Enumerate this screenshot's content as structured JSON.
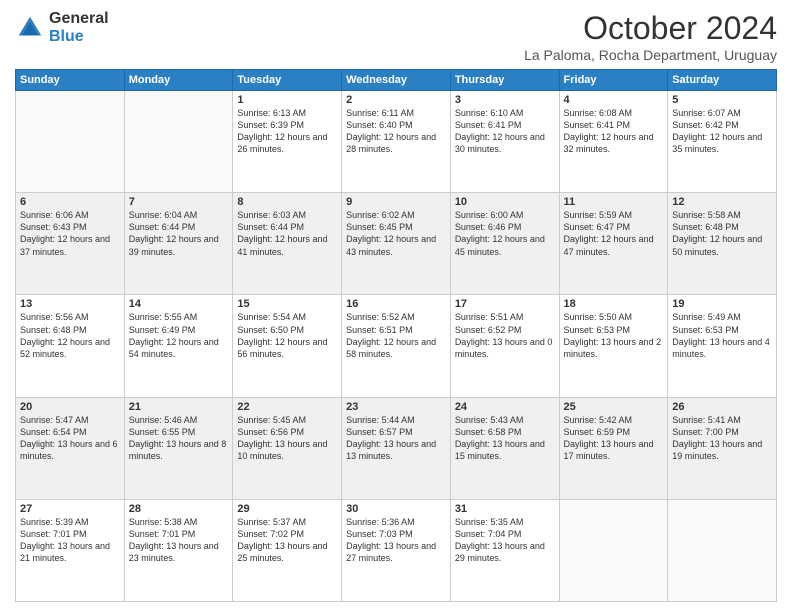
{
  "logo": {
    "general": "General",
    "blue": "Blue"
  },
  "header": {
    "month": "October 2024",
    "location": "La Paloma, Rocha Department, Uruguay"
  },
  "days_of_week": [
    "Sunday",
    "Monday",
    "Tuesday",
    "Wednesday",
    "Thursday",
    "Friday",
    "Saturday"
  ],
  "weeks": [
    [
      {
        "day": "",
        "info": ""
      },
      {
        "day": "",
        "info": ""
      },
      {
        "day": "1",
        "info": "Sunrise: 6:13 AM\nSunset: 6:39 PM\nDaylight: 12 hours and 26 minutes."
      },
      {
        "day": "2",
        "info": "Sunrise: 6:11 AM\nSunset: 6:40 PM\nDaylight: 12 hours and 28 minutes."
      },
      {
        "day": "3",
        "info": "Sunrise: 6:10 AM\nSunset: 6:41 PM\nDaylight: 12 hours and 30 minutes."
      },
      {
        "day": "4",
        "info": "Sunrise: 6:08 AM\nSunset: 6:41 PM\nDaylight: 12 hours and 32 minutes."
      },
      {
        "day": "5",
        "info": "Sunrise: 6:07 AM\nSunset: 6:42 PM\nDaylight: 12 hours and 35 minutes."
      }
    ],
    [
      {
        "day": "6",
        "info": "Sunrise: 6:06 AM\nSunset: 6:43 PM\nDaylight: 12 hours and 37 minutes."
      },
      {
        "day": "7",
        "info": "Sunrise: 6:04 AM\nSunset: 6:44 PM\nDaylight: 12 hours and 39 minutes."
      },
      {
        "day": "8",
        "info": "Sunrise: 6:03 AM\nSunset: 6:44 PM\nDaylight: 12 hours and 41 minutes."
      },
      {
        "day": "9",
        "info": "Sunrise: 6:02 AM\nSunset: 6:45 PM\nDaylight: 12 hours and 43 minutes."
      },
      {
        "day": "10",
        "info": "Sunrise: 6:00 AM\nSunset: 6:46 PM\nDaylight: 12 hours and 45 minutes."
      },
      {
        "day": "11",
        "info": "Sunrise: 5:59 AM\nSunset: 6:47 PM\nDaylight: 12 hours and 47 minutes."
      },
      {
        "day": "12",
        "info": "Sunrise: 5:58 AM\nSunset: 6:48 PM\nDaylight: 12 hours and 50 minutes."
      }
    ],
    [
      {
        "day": "13",
        "info": "Sunrise: 5:56 AM\nSunset: 6:48 PM\nDaylight: 12 hours and 52 minutes."
      },
      {
        "day": "14",
        "info": "Sunrise: 5:55 AM\nSunset: 6:49 PM\nDaylight: 12 hours and 54 minutes."
      },
      {
        "day": "15",
        "info": "Sunrise: 5:54 AM\nSunset: 6:50 PM\nDaylight: 12 hours and 56 minutes."
      },
      {
        "day": "16",
        "info": "Sunrise: 5:52 AM\nSunset: 6:51 PM\nDaylight: 12 hours and 58 minutes."
      },
      {
        "day": "17",
        "info": "Sunrise: 5:51 AM\nSunset: 6:52 PM\nDaylight: 13 hours and 0 minutes."
      },
      {
        "day": "18",
        "info": "Sunrise: 5:50 AM\nSunset: 6:53 PM\nDaylight: 13 hours and 2 minutes."
      },
      {
        "day": "19",
        "info": "Sunrise: 5:49 AM\nSunset: 6:53 PM\nDaylight: 13 hours and 4 minutes."
      }
    ],
    [
      {
        "day": "20",
        "info": "Sunrise: 5:47 AM\nSunset: 6:54 PM\nDaylight: 13 hours and 6 minutes."
      },
      {
        "day": "21",
        "info": "Sunrise: 5:46 AM\nSunset: 6:55 PM\nDaylight: 13 hours and 8 minutes."
      },
      {
        "day": "22",
        "info": "Sunrise: 5:45 AM\nSunset: 6:56 PM\nDaylight: 13 hours and 10 minutes."
      },
      {
        "day": "23",
        "info": "Sunrise: 5:44 AM\nSunset: 6:57 PM\nDaylight: 13 hours and 13 minutes."
      },
      {
        "day": "24",
        "info": "Sunrise: 5:43 AM\nSunset: 6:58 PM\nDaylight: 13 hours and 15 minutes."
      },
      {
        "day": "25",
        "info": "Sunrise: 5:42 AM\nSunset: 6:59 PM\nDaylight: 13 hours and 17 minutes."
      },
      {
        "day": "26",
        "info": "Sunrise: 5:41 AM\nSunset: 7:00 PM\nDaylight: 13 hours and 19 minutes."
      }
    ],
    [
      {
        "day": "27",
        "info": "Sunrise: 5:39 AM\nSunset: 7:01 PM\nDaylight: 13 hours and 21 minutes."
      },
      {
        "day": "28",
        "info": "Sunrise: 5:38 AM\nSunset: 7:01 PM\nDaylight: 13 hours and 23 minutes."
      },
      {
        "day": "29",
        "info": "Sunrise: 5:37 AM\nSunset: 7:02 PM\nDaylight: 13 hours and 25 minutes."
      },
      {
        "day": "30",
        "info": "Sunrise: 5:36 AM\nSunset: 7:03 PM\nDaylight: 13 hours and 27 minutes."
      },
      {
        "day": "31",
        "info": "Sunrise: 5:35 AM\nSunset: 7:04 PM\nDaylight: 13 hours and 29 minutes."
      },
      {
        "day": "",
        "info": ""
      },
      {
        "day": "",
        "info": ""
      }
    ]
  ]
}
